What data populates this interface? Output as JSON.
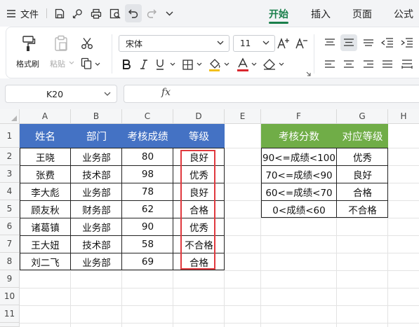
{
  "menubar": {
    "file_label": "文件",
    "tabs": [
      {
        "label": "开始",
        "active": true
      },
      {
        "label": "插入",
        "active": false
      },
      {
        "label": "页面",
        "active": false
      },
      {
        "label": "公式",
        "active": false
      }
    ]
  },
  "ribbon": {
    "format_painter": "格式刷",
    "paste": "粘贴",
    "font_name": "宋体",
    "font_size": "11"
  },
  "formula_bar": {
    "name_box": "K20",
    "fx": "fx",
    "value": ""
  },
  "sheet": {
    "columns": [
      "A",
      "B",
      "C",
      "D",
      "E",
      "F",
      "G",
      "H"
    ],
    "rows": [
      "1",
      "2",
      "3",
      "4",
      "5",
      "6",
      "7",
      "8",
      "9",
      "10",
      "11"
    ],
    "main_table": {
      "headers": [
        "姓名",
        "部门",
        "考核成绩",
        "等级"
      ],
      "rows": [
        [
          "王晓",
          "业务部",
          "80",
          "良好"
        ],
        [
          "张费",
          "技术部",
          "98",
          "优秀"
        ],
        [
          "李大彪",
          "业务部",
          "78",
          "良好"
        ],
        [
          "顾友秋",
          "财务部",
          "62",
          "合格"
        ],
        [
          "诸葛镇",
          "业务部",
          "90",
          "优秀"
        ],
        [
          "王大妞",
          "技术部",
          "58",
          "不合格"
        ],
        [
          "刘二飞",
          "业务部",
          "69",
          "合格"
        ]
      ]
    },
    "lookup_table": {
      "headers": [
        "考核分数",
        "对应等级"
      ],
      "rows": [
        [
          "90<=成绩<100",
          "优秀"
        ],
        [
          "70<=成绩<90",
          "良好"
        ],
        [
          "60<=成绩<70",
          "合格"
        ],
        [
          "0<成绩<60",
          "不合格"
        ]
      ]
    }
  },
  "colors": {
    "accent_green": "#1a7f4b",
    "header_blue": "#4472c4",
    "header_green": "#70ad47",
    "highlight_red": "#e0393e"
  }
}
